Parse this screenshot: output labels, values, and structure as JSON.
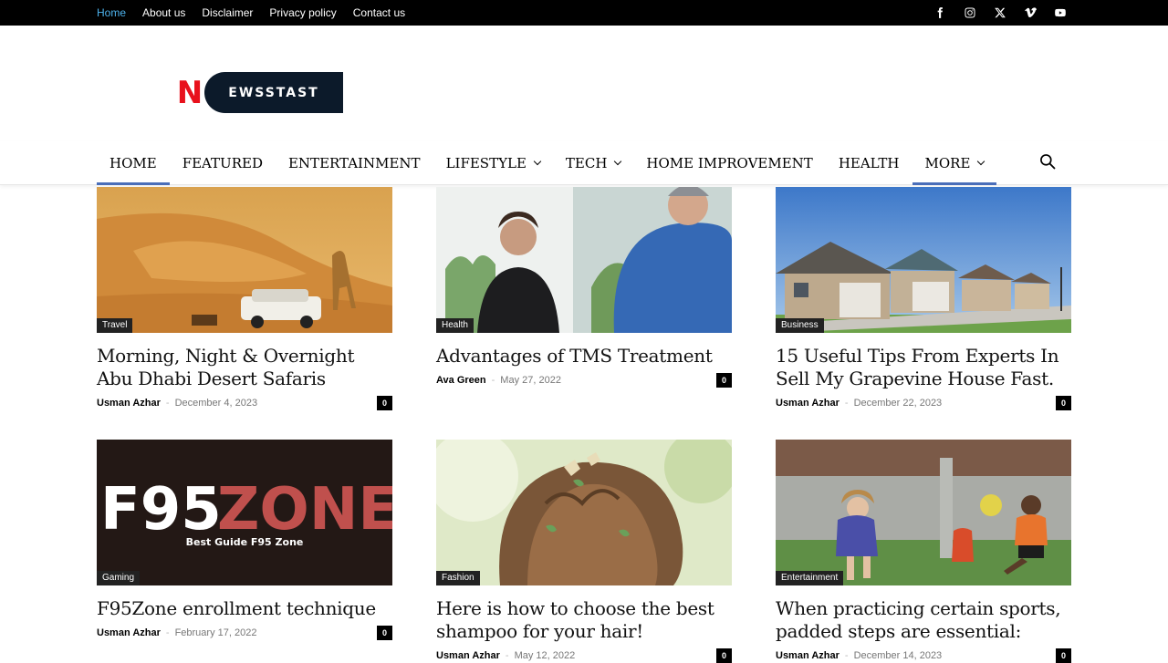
{
  "topnav": [
    {
      "label": "Home",
      "active": true
    },
    {
      "label": "About us"
    },
    {
      "label": "Disclaimer"
    },
    {
      "label": "Privacy policy"
    },
    {
      "label": "Contact us"
    }
  ],
  "social_icons": [
    "facebook-icon",
    "instagram-icon",
    "x-icon",
    "vimeo-icon",
    "youtube-icon"
  ],
  "logo": {
    "letter": "N",
    "text": "EWSSTAST"
  },
  "mainnav": [
    {
      "label": "HOME"
    },
    {
      "label": "FEATURED"
    },
    {
      "label": "ENTERTAINMENT"
    },
    {
      "label": "LIFESTYLE"
    },
    {
      "label": "TECH"
    },
    {
      "label": "HOME IMPROVEMENT"
    },
    {
      "label": "HEALTH"
    },
    {
      "label": "MORE"
    }
  ],
  "colors": {
    "accent": "#4a6eb9",
    "topbar": "#000000",
    "logo_red": "#e8111c",
    "active_link": "#4db2ec"
  },
  "posts": [
    {
      "category": "Travel",
      "title": "Morning, Night & Overnight Abu Dhabi Desert Safaris",
      "author": "Usman Azhar",
      "date": "December 4, 2023",
      "comments": "0"
    },
    {
      "category": "Health",
      "title": "Advantages of TMS Treatment",
      "author": "Ava Green",
      "date": "May 27, 2022",
      "comments": "0"
    },
    {
      "category": "Business",
      "title": "15 Useful Tips From Experts In Sell My Grapevine House Fast.",
      "author": "Usman Azhar",
      "date": "December 22, 2023",
      "comments": "0"
    },
    {
      "category": "Gaming",
      "title": "F95Zone enrollment technique",
      "author": "Usman Azhar",
      "date": "February 17, 2022",
      "comments": "0"
    },
    {
      "category": "Fashion",
      "title": "Here is how to choose the best shampoo for your hair!",
      "author": "Usman Azhar",
      "date": "May 12, 2022",
      "comments": "0"
    },
    {
      "category": "Entertainment",
      "title": "When practicing certain sports, padded steps are essential:",
      "author": "Usman Azhar",
      "date": "December 14, 2023",
      "comments": "0"
    }
  ],
  "f95": {
    "brand_a": "F95",
    "brand_b": "ZONE",
    "tagline": "Best Guide F95 Zone"
  }
}
